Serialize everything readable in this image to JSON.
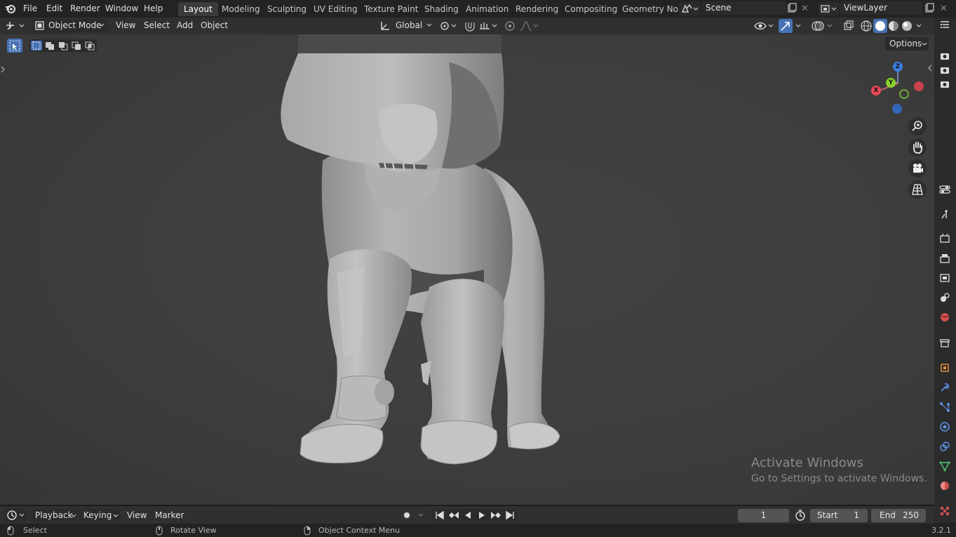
{
  "topbar": {
    "menus": [
      "File",
      "Edit",
      "Render",
      "Window",
      "Help"
    ],
    "workspaces": [
      "Layout",
      "Modeling",
      "Sculpting",
      "UV Editing",
      "Texture Paint",
      "Shading",
      "Animation",
      "Rendering",
      "Compositing",
      "Geometry Noc"
    ],
    "active_workspace": "Layout",
    "scene": "Scene",
    "view_layer": "ViewLayer"
  },
  "viewport_header": {
    "mode": "Object Mode",
    "menus": [
      "View",
      "Select",
      "Add",
      "Object"
    ],
    "transform_orientation": "Global",
    "options_label": "Options"
  },
  "gizmo": {
    "x": "X",
    "y": "Y",
    "z": "Z",
    "x_color": "#e94a59",
    "y_color": "#88d02f",
    "z_color": "#3a7ee6"
  },
  "watermark": {
    "title": "Activate Windows",
    "subtitle": "Go to Settings to activate Windows."
  },
  "timeline": {
    "menus": [
      "Playback",
      "Keying",
      "View",
      "Marker"
    ],
    "current_frame": "1",
    "start_label": "Start",
    "start": "1",
    "end_label": "End",
    "end": "250"
  },
  "statusbar": {
    "select": "Select",
    "rotate": "Rotate View",
    "context": "Object Context Menu",
    "version": "3.2.1"
  },
  "colors": {
    "accent": "#4772b3",
    "panel": "#303030",
    "viewport": "#3d3d3d"
  }
}
